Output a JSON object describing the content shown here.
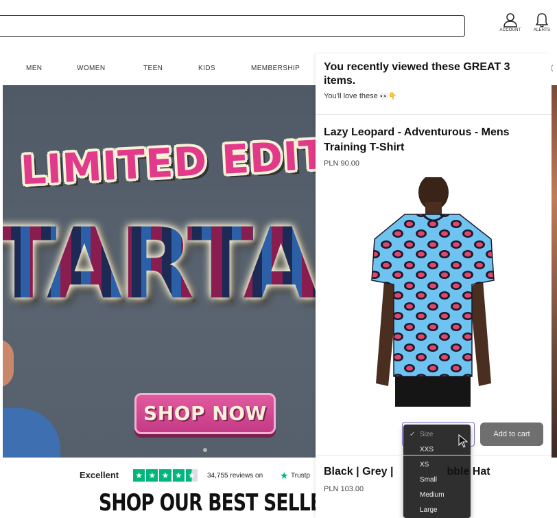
{
  "header": {
    "account_label": "ACCOUNT",
    "alerts_label": "ALERTS",
    "account_icon": "user-icon",
    "alerts_icon": "bell-icon"
  },
  "nav": {
    "items": [
      "MEN",
      "WOMEN",
      "TEEN",
      "KIDS",
      "MEMBERSHIP"
    ],
    "edge_fragment": "("
  },
  "hero": {
    "line1": "LIMITED EDITI",
    "line2": "TARTA",
    "cta": "SHOP NOW"
  },
  "trust": {
    "rating_word": "Excellent",
    "stars": 4.5,
    "reviews": "34,755 reviews on",
    "brand": "Trustp"
  },
  "section_heading": "SHOP OUR BEST SELLERS",
  "panel": {
    "title": "You recently viewed these GREAT 3 items.",
    "subtitle": "You'll love these",
    "subtitle_emoji": "👀👇",
    "product1": {
      "name": "Lazy Leopard - Adventurous - Mens Training T-Shirt",
      "price": "PLN 90.00",
      "add_to_cart": "Add to cart"
    },
    "size_select": {
      "selected": "Size",
      "options": [
        "XXS",
        "XS",
        "Small",
        "Medium",
        "Large"
      ]
    },
    "product2": {
      "name_left": "Black | Grey |",
      "name_right": "bble Hat",
      "price": "PLN 103.00"
    }
  },
  "colors": {
    "accent_pink": "#e23a8a",
    "trust_green": "#00b67a",
    "button_grey": "#6f6f6f",
    "select_border": "#7b6fd0"
  }
}
